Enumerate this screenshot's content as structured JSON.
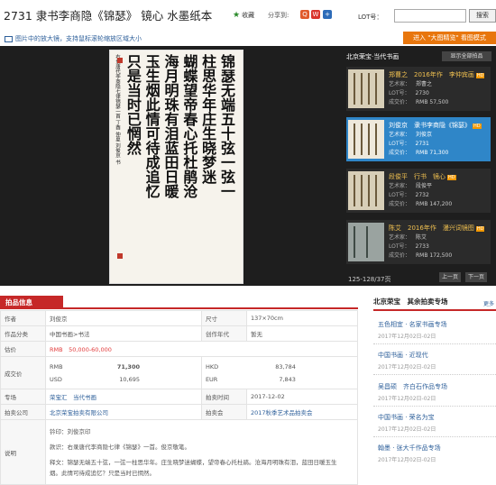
{
  "header": {
    "title": "2731 隶书李商隐《锦瑟》 镜心 水墨纸本",
    "favorite_label": "收藏",
    "share_label": "分享到:",
    "lot_label": "LOT号：",
    "lot_input_value": "",
    "search_label": "搜索"
  },
  "hint_text": "图片中的放大镜，支持鼠标滚轮缩放区域大小",
  "mode_button": "进入 \"大图精览\" 看图模式",
  "artwork": {
    "columns": [
      "锦瑟无端五十弦一弦一",
      "柱思华年庄生晓梦迷",
      "蝴蝶望帝春心托杜鹃沧",
      "海月明珠有泪蓝田日暖",
      "玉生烟此情可待成追忆",
      "只是当时已惘然"
    ],
    "inscription": "右录唐代李商隐七律锦瑟一首 丁酉 仲夏 刘俊京 书"
  },
  "sidebar": {
    "heading": "北京荣宝·当代书画",
    "show_all": "显示全部拍品",
    "cards": [
      {
        "title": "郑曹之　2016年作　李仲宾画",
        "artist_label": "艺术家：",
        "artist": "郑曹之",
        "lot_label": "LOT号：",
        "lot": "2730",
        "price_label": "成交价：",
        "price": "RMB 57,500",
        "active": false
      },
      {
        "title": "刘俊京　隶书李商隐《锦瑟》",
        "artist_label": "艺术家：",
        "artist": "刘俊京",
        "lot_label": "LOT号：",
        "lot": "2731",
        "price_label": "成交价：",
        "price": "RMB 71,300",
        "active": true
      },
      {
        "title": "段俊平　行书　镜心",
        "artist_label": "艺术家：",
        "artist": "段俊平",
        "lot_label": "LOT号：",
        "lot": "2732",
        "price_label": "成交价：",
        "price": "RMB 147,200",
        "active": false
      },
      {
        "title": "陈艾　2016年作　漫兴词镜图",
        "artist_label": "艺术家：",
        "artist": "陈艾",
        "lot_label": "LOT号：",
        "lot": "2733",
        "price_label": "成交价：",
        "price": "RMB 172,500",
        "active": false
      }
    ],
    "hd_badge": "HD",
    "pager": "125-128/37页",
    "prev": "上一页",
    "next": "下一页"
  },
  "info": {
    "heading": "拍品信息",
    "author_k": "作者",
    "author_v": "刘俊京",
    "size_k": "尺寸",
    "size_v": "137×70cm",
    "category_k": "作品分类",
    "category_v": "中国书画>书法",
    "year_k": "创作年代",
    "year_v": "暂无",
    "estimate_k": "估价",
    "estimate_v": "RMB　50,000-60,000",
    "deal_k": "成交价",
    "deal_rmb_c": "RMB",
    "deal_rmb_v": "71,300",
    "deal_hkd_c": "HKD",
    "deal_hkd_v": "83,784",
    "deal_usd_c": "USD",
    "deal_usd_v": "10,695",
    "deal_eur_c": "EUR",
    "deal_eur_v": "7,843",
    "session_k": "专场",
    "session_v": "荣宝汇　当代书画",
    "time_k": "拍卖时间",
    "time_v": "2017-12-02",
    "company_k": "拍卖公司",
    "company_v": "北京荣宝拍卖有限公司",
    "auction_k": "拍卖会",
    "auction_v": "2017秋季艺术品拍卖会",
    "desc_k": "说明",
    "desc_1": "钤印：刘俊京印",
    "desc_2": "款识：右录唐代李商隐七律《锦瑟》一首。俊京敬笔。",
    "desc_3": "释文：锦瑟无端五十弦，一弦一柱思华年。庄生晓梦迷蝴蝶，望帝春心托杜鹃。沧海月明珠有泪，蓝田日暖玉生",
    "desc_4": "烟。此情可待成追忆？只是当时已惘然。"
  },
  "right_panel": {
    "heading": "北京荣宝　其余拍卖专场",
    "more": "更多",
    "items": [
      {
        "name": "五色相宜 · 名家书画专场",
        "date": "2017年12月02日-02日"
      },
      {
        "name": "中国书画 · 近现代",
        "date": "2017年12月02日-02日"
      },
      {
        "name": "吴昌硕　齐白石作品专场",
        "date": "2017年12月02日-02日"
      },
      {
        "name": "中国书画 · 荣名为宝",
        "date": "2017年12月02日-02日"
      },
      {
        "name": "翰墨 · 张大千作品专场",
        "date": "2017年12月02日-02日"
      }
    ]
  }
}
